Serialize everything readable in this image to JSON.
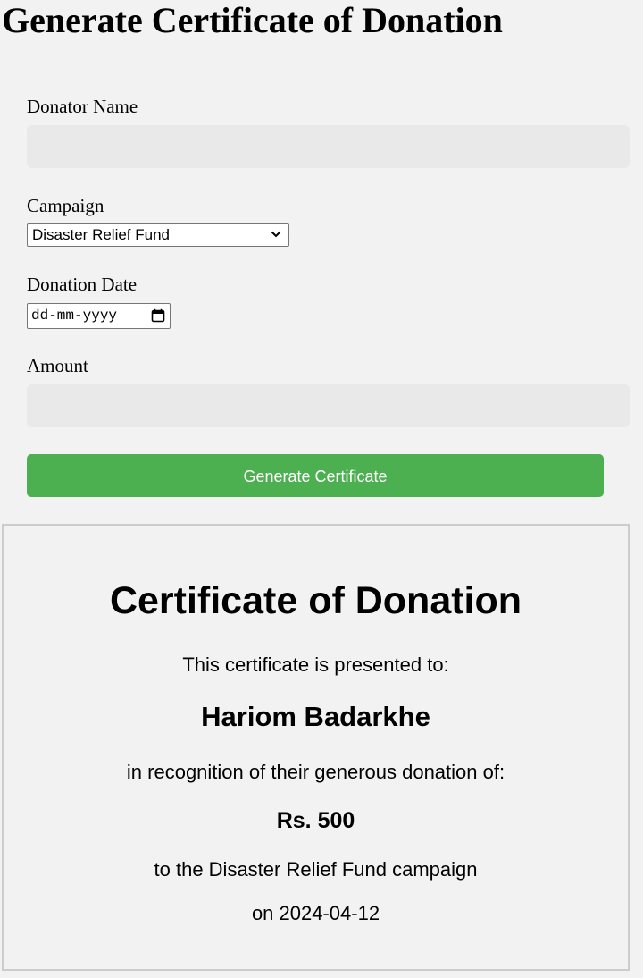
{
  "page": {
    "title": "Generate Certificate of Donation"
  },
  "form": {
    "donator_name_label": "Donator Name",
    "donator_name_value": "",
    "campaign_label": "Campaign",
    "campaign_selected": "Disaster Relief Fund",
    "donation_date_label": "Donation Date",
    "donation_date_placeholder": "dd-mm-yyyy",
    "amount_label": "Amount",
    "amount_value": "",
    "generate_button_label": "Generate Certificate"
  },
  "certificate": {
    "title": "Certificate of Donation",
    "presented_text": "This certificate is presented to:",
    "recipient_name": "Hariom Badarkhe",
    "recognition_text": "in recognition of their generous donation of:",
    "amount_text": "Rs. 500",
    "campaign_text": "to the Disaster Relief Fund campaign",
    "date_text": "on 2024-04-12"
  },
  "colors": {
    "page_background": "#f2f2f2",
    "input_background": "#e9e9e9",
    "button_background": "#4caf50",
    "button_text": "#ffffff",
    "certificate_border": "#cccccc"
  },
  "icons": {
    "select_chevron": "chevron-down-icon",
    "date_picker": "calendar-icon"
  }
}
